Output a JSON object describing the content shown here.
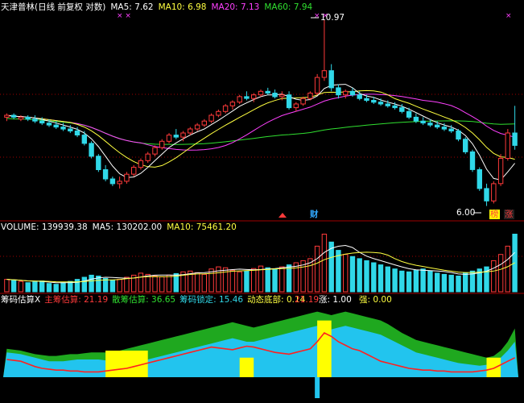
{
  "colors": {
    "up": "#ff3a3a",
    "down": "#30d8e8",
    "ma5": "#ffffff",
    "ma10": "#ffff40",
    "ma20": "#ff40ff",
    "ma60": "#30e030",
    "grid": "#a00000",
    "green_area": "#1fa81f",
    "cyan_area": "#22c4ee",
    "yellow_area": "#ffff00"
  },
  "price_panel": {
    "stock_name": "天津普林(日线 前复权 对数)",
    "ma5_label": "MA5:",
    "ma5_value": "7.62",
    "ma10_label": "MA10:",
    "ma10_value": "6.98",
    "ma20_label": "MA20:",
    "ma20_value": "7.13",
    "ma60_label": "MA60:",
    "ma60_value": "7.94",
    "high_marker": "10.97",
    "low_marker": "6.00",
    "marker_cai": "财",
    "badge_bang": "榜",
    "badge_zhang": "涨"
  },
  "volume_panel": {
    "volume_label": "VOLUME:",
    "volume_value": "139939.38",
    "ma5_label": "MA5:",
    "ma5_value": "130202.00",
    "ma10_label": "MA10:",
    "ma10_value": "75461.20"
  },
  "chip_panel": {
    "title": "筹码估算X",
    "main_label": "主筹估算:",
    "main_value": "21.19",
    "loose_label": "散筹估算:",
    "loose_value": "36.65",
    "lock_label": "筹码锁定:",
    "lock_value": "15.46",
    "bottom_label": "动态底部:",
    "bottom_value": "0.14",
    "mid_value": "21.19",
    "zhang_label": "涨:",
    "zhang_value": "1.00",
    "qiang_label": "强:",
    "qiang_value": "0.00"
  },
  "chart_data": {
    "type": "candlestick",
    "price_axis": "log",
    "marked_high": 10.97,
    "marked_low": 6.0,
    "candles": [
      {
        "o": 8.0,
        "h": 8.1,
        "l": 7.9,
        "c": 8.05
      },
      {
        "o": 8.05,
        "h": 8.1,
        "l": 7.95,
        "c": 8.0
      },
      {
        "o": 7.95,
        "h": 8.05,
        "l": 7.9,
        "c": 8.0
      },
      {
        "o": 8.0,
        "h": 8.05,
        "l": 7.9,
        "c": 7.95
      },
      {
        "o": 7.95,
        "h": 8.05,
        "l": 7.85,
        "c": 7.9
      },
      {
        "o": 7.9,
        "h": 8.0,
        "l": 7.8,
        "c": 7.85
      },
      {
        "o": 7.85,
        "h": 7.95,
        "l": 7.75,
        "c": 7.8
      },
      {
        "o": 7.8,
        "h": 7.9,
        "l": 7.7,
        "c": 7.75
      },
      {
        "o": 7.75,
        "h": 7.85,
        "l": 7.65,
        "c": 7.7
      },
      {
        "o": 7.7,
        "h": 7.8,
        "l": 7.6,
        "c": 7.65
      },
      {
        "o": 7.65,
        "h": 7.75,
        "l": 7.5,
        "c": 7.55
      },
      {
        "o": 7.55,
        "h": 7.65,
        "l": 7.3,
        "c": 7.35
      },
      {
        "o": 7.35,
        "h": 7.4,
        "l": 7.0,
        "c": 7.05
      },
      {
        "o": 7.05,
        "h": 7.1,
        "l": 6.7,
        "c": 6.75
      },
      {
        "o": 6.75,
        "h": 6.85,
        "l": 6.5,
        "c": 6.55
      },
      {
        "o": 6.55,
        "h": 6.6,
        "l": 6.4,
        "c": 6.45
      },
      {
        "o": 6.45,
        "h": 6.6,
        "l": 6.35,
        "c": 6.5
      },
      {
        "o": 6.5,
        "h": 6.7,
        "l": 6.45,
        "c": 6.65
      },
      {
        "o": 6.65,
        "h": 6.85,
        "l": 6.6,
        "c": 6.8
      },
      {
        "o": 6.8,
        "h": 7.0,
        "l": 6.75,
        "c": 6.95
      },
      {
        "o": 6.95,
        "h": 7.15,
        "l": 6.9,
        "c": 7.1
      },
      {
        "o": 7.1,
        "h": 7.3,
        "l": 7.05,
        "c": 7.25
      },
      {
        "o": 7.25,
        "h": 7.45,
        "l": 7.2,
        "c": 7.4
      },
      {
        "o": 7.4,
        "h": 7.6,
        "l": 7.35,
        "c": 7.55
      },
      {
        "o": 7.55,
        "h": 7.7,
        "l": 7.45,
        "c": 7.5
      },
      {
        "o": 7.5,
        "h": 7.65,
        "l": 7.4,
        "c": 7.6
      },
      {
        "o": 7.6,
        "h": 7.75,
        "l": 7.55,
        "c": 7.7
      },
      {
        "o": 7.7,
        "h": 7.85,
        "l": 7.65,
        "c": 7.8
      },
      {
        "o": 7.8,
        "h": 7.95,
        "l": 7.75,
        "c": 7.9
      },
      {
        "o": 7.9,
        "h": 8.1,
        "l": 7.85,
        "c": 8.05
      },
      {
        "o": 8.05,
        "h": 8.2,
        "l": 8.0,
        "c": 8.15
      },
      {
        "o": 8.15,
        "h": 8.35,
        "l": 8.1,
        "c": 8.3
      },
      {
        "o": 8.3,
        "h": 8.45,
        "l": 8.2,
        "c": 8.4
      },
      {
        "o": 8.4,
        "h": 8.6,
        "l": 8.35,
        "c": 8.55
      },
      {
        "o": 8.55,
        "h": 8.7,
        "l": 8.45,
        "c": 8.5
      },
      {
        "o": 8.5,
        "h": 8.65,
        "l": 8.4,
        "c": 8.6
      },
      {
        "o": 8.6,
        "h": 8.75,
        "l": 8.55,
        "c": 8.7
      },
      {
        "o": 8.7,
        "h": 8.8,
        "l": 8.6,
        "c": 8.65
      },
      {
        "o": 8.65,
        "h": 8.75,
        "l": 8.5,
        "c": 8.55
      },
      {
        "o": 8.55,
        "h": 8.7,
        "l": 8.45,
        "c": 8.6
      },
      {
        "o": 8.6,
        "h": 8.7,
        "l": 8.2,
        "c": 8.25
      },
      {
        "o": 8.25,
        "h": 8.4,
        "l": 8.15,
        "c": 8.35
      },
      {
        "o": 8.35,
        "h": 8.55,
        "l": 8.3,
        "c": 8.5
      },
      {
        "o": 8.5,
        "h": 8.7,
        "l": 8.45,
        "c": 8.65
      },
      {
        "o": 8.65,
        "h": 9.2,
        "l": 8.6,
        "c": 9.1
      },
      {
        "o": 9.1,
        "h": 10.97,
        "l": 9.0,
        "c": 9.3
      },
      {
        "o": 9.3,
        "h": 9.5,
        "l": 8.7,
        "c": 8.8
      },
      {
        "o": 8.8,
        "h": 8.9,
        "l": 8.5,
        "c": 8.6
      },
      {
        "o": 8.6,
        "h": 8.75,
        "l": 8.5,
        "c": 8.7
      },
      {
        "o": 8.7,
        "h": 8.8,
        "l": 8.55,
        "c": 8.6
      },
      {
        "o": 8.6,
        "h": 8.7,
        "l": 8.45,
        "c": 8.5
      },
      {
        "o": 8.5,
        "h": 8.6,
        "l": 8.4,
        "c": 8.45
      },
      {
        "o": 8.45,
        "h": 8.55,
        "l": 8.35,
        "c": 8.4
      },
      {
        "o": 8.4,
        "h": 8.5,
        "l": 8.3,
        "c": 8.35
      },
      {
        "o": 8.35,
        "h": 8.45,
        "l": 8.25,
        "c": 8.3
      },
      {
        "o": 8.3,
        "h": 8.4,
        "l": 8.2,
        "c": 8.25
      },
      {
        "o": 8.25,
        "h": 8.35,
        "l": 8.1,
        "c": 8.15
      },
      {
        "o": 8.15,
        "h": 8.25,
        "l": 7.95,
        "c": 8.0
      },
      {
        "o": 8.0,
        "h": 8.1,
        "l": 7.85,
        "c": 7.9
      },
      {
        "o": 7.9,
        "h": 8.0,
        "l": 7.8,
        "c": 7.85
      },
      {
        "o": 7.85,
        "h": 7.95,
        "l": 7.75,
        "c": 7.8
      },
      {
        "o": 7.8,
        "h": 7.9,
        "l": 7.7,
        "c": 7.75
      },
      {
        "o": 7.75,
        "h": 7.85,
        "l": 7.65,
        "c": 7.7
      },
      {
        "o": 7.7,
        "h": 7.8,
        "l": 7.6,
        "c": 7.65
      },
      {
        "o": 7.65,
        "h": 7.7,
        "l": 7.4,
        "c": 7.45
      },
      {
        "o": 7.45,
        "h": 7.5,
        "l": 7.1,
        "c": 7.15
      },
      {
        "o": 7.15,
        "h": 7.2,
        "l": 6.7,
        "c": 6.75
      },
      {
        "o": 6.75,
        "h": 6.8,
        "l": 6.3,
        "c": 6.35
      },
      {
        "o": 6.35,
        "h": 6.45,
        "l": 6.0,
        "c": 6.1
      },
      {
        "o": 6.1,
        "h": 6.5,
        "l": 6.05,
        "c": 6.45
      },
      {
        "o": 6.45,
        "h": 7.1,
        "l": 6.4,
        "c": 7.0
      },
      {
        "o": 7.0,
        "h": 7.7,
        "l": 6.95,
        "c": 7.6
      },
      {
        "o": 7.6,
        "h": 8.3,
        "l": 7.2,
        "c": 7.3
      }
    ],
    "volume": [
      30,
      28,
      25,
      22,
      24,
      26,
      20,
      18,
      22,
      25,
      30,
      35,
      40,
      38,
      32,
      28,
      30,
      35,
      40,
      45,
      42,
      38,
      36,
      40,
      44,
      48,
      50,
      46,
      42,
      55,
      60,
      58,
      52,
      48,
      50,
      56,
      62,
      58,
      54,
      60,
      65,
      70,
      75,
      80,
      110,
      139,
      120,
      100,
      90,
      85,
      80,
      75,
      70,
      65,
      60,
      55,
      50,
      48,
      52,
      55,
      50,
      45,
      42,
      40,
      38,
      45,
      50,
      55,
      60,
      75,
      90,
      110,
      139
    ],
    "chip_main_line": [
      20,
      19,
      18,
      15,
      12,
      10,
      9,
      8,
      8,
      7,
      7,
      6,
      6,
      6,
      7,
      8,
      9,
      10,
      12,
      14,
      16,
      18,
      20,
      22,
      24,
      26,
      28,
      30,
      32,
      34,
      33,
      32,
      31,
      33,
      35,
      34,
      32,
      30,
      28,
      27,
      26,
      28,
      30,
      32,
      40,
      50,
      46,
      40,
      36,
      32,
      30,
      26,
      22,
      18,
      16,
      14,
      12,
      10,
      9,
      8,
      8,
      7,
      7,
      6,
      6,
      6,
      6,
      7,
      8,
      10,
      14,
      18,
      22
    ],
    "chip_green_area": [
      32,
      31,
      30,
      28,
      26,
      25,
      24,
      24,
      25,
      26,
      26,
      27,
      28,
      28,
      28,
      29,
      30,
      32,
      34,
      36,
      38,
      40,
      42,
      44,
      46,
      48,
      50,
      52,
      54,
      56,
      58,
      60,
      62,
      60,
      58,
      56,
      58,
      60,
      62,
      64,
      66,
      68,
      70,
      72,
      74,
      72,
      70,
      72,
      74,
      72,
      70,
      68,
      66,
      64,
      60,
      55,
      50,
      46,
      42,
      40,
      38,
      36,
      34,
      32,
      30,
      28,
      26,
      24,
      22,
      24,
      30,
      40,
      55
    ],
    "chip_cyan_area": [
      28,
      27,
      26,
      24,
      22,
      20,
      18,
      18,
      18,
      19,
      20,
      20,
      20,
      20,
      19,
      18,
      17,
      17,
      18,
      19,
      20,
      22,
      24,
      26,
      28,
      30,
      32,
      34,
      36,
      38,
      40,
      42,
      44,
      42,
      40,
      40,
      42,
      44,
      46,
      48,
      50,
      52,
      54,
      56,
      58,
      56,
      54,
      56,
      58,
      56,
      54,
      52,
      50,
      48,
      44,
      40,
      36,
      32,
      28,
      26,
      24,
      22,
      20,
      18,
      16,
      15,
      14,
      13,
      14,
      16,
      22,
      30,
      40
    ]
  }
}
